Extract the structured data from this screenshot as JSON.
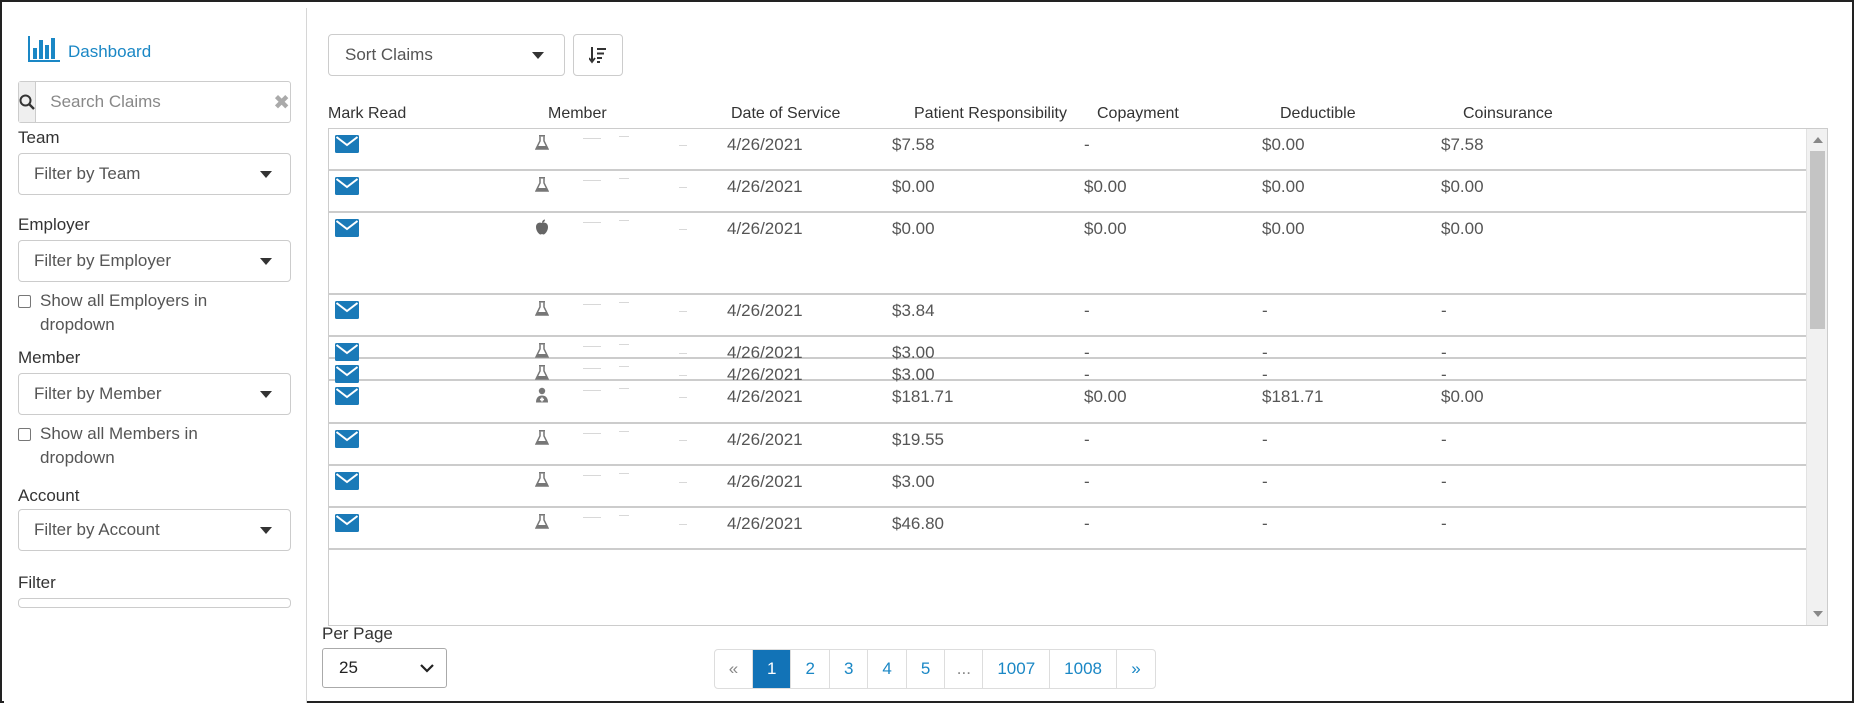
{
  "sidebar": {
    "dashboard_label": "Dashboard",
    "search": {
      "placeholder": "Search Claims",
      "clear_glyph": "✖"
    },
    "team": {
      "label": "Team",
      "placeholder": "Filter by Team"
    },
    "employer": {
      "label": "Employer",
      "placeholder": "Filter by Employer",
      "show_all_label": "Show all Employers in dropdown"
    },
    "member": {
      "label": "Member",
      "placeholder": "Filter by Member",
      "show_all_label": "Show all Members in dropdown"
    },
    "account": {
      "label": "Account",
      "placeholder": "Filter by Account"
    },
    "filter": {
      "label": "Filter"
    }
  },
  "toolbar": {
    "sort_placeholder": "Sort Claims"
  },
  "table": {
    "headers": {
      "mark_read": "Mark Read",
      "member": "Member",
      "date_of_service": "Date of Service",
      "patient_responsibility": "Patient Responsibility",
      "copayment": "Copayment",
      "deductible": "Deductible",
      "coinsurance": "Coinsurance"
    },
    "rows": [
      {
        "type_icon": "flask-icon",
        "date": "4/26/2021",
        "patient_resp": "$7.58",
        "copay": "-",
        "deductible": "$0.00",
        "coinsurance": "$7.58"
      },
      {
        "type_icon": "flask-icon",
        "date": "4/26/2021",
        "patient_resp": "$0.00",
        "copay": "$0.00",
        "deductible": "$0.00",
        "coinsurance": "$0.00"
      },
      {
        "type_icon": "apple-icon",
        "date": "4/26/2021",
        "patient_resp": "$0.00",
        "copay": "$0.00",
        "deductible": "$0.00",
        "coinsurance": "$0.00"
      },
      {
        "type_icon": "flask-icon",
        "date": "4/26/2021",
        "patient_resp": "$3.84",
        "copay": "-",
        "deductible": "-",
        "coinsurance": "-"
      },
      {
        "type_icon": "flask-icon",
        "date": "4/26/2021",
        "patient_resp": "$3.00",
        "copay": "-",
        "deductible": "-",
        "coinsurance": "-"
      },
      {
        "type_icon": "flask-icon",
        "date": "4/26/2021",
        "patient_resp": "$3.00",
        "copay": "-",
        "deductible": "-",
        "coinsurance": "-"
      },
      {
        "type_icon": "doctor-icon",
        "date": "4/26/2021",
        "patient_resp": "$181.71",
        "copay": "$0.00",
        "deductible": "$181.71",
        "coinsurance": "$0.00"
      },
      {
        "type_icon": "flask-icon",
        "date": "4/26/2021",
        "patient_resp": "$19.55",
        "copay": "-",
        "deductible": "-",
        "coinsurance": "-"
      },
      {
        "type_icon": "flask-icon",
        "date": "4/26/2021",
        "patient_resp": "$3.00",
        "copay": "-",
        "deductible": "-",
        "coinsurance": "-"
      },
      {
        "type_icon": "flask-icon",
        "date": "4/26/2021",
        "patient_resp": "$46.80",
        "copay": "-",
        "deductible": "-",
        "coinsurance": "-"
      }
    ]
  },
  "pagination": {
    "per_page_label": "Per Page",
    "per_page_value": "25",
    "pages": [
      "«",
      "1",
      "2",
      "3",
      "4",
      "5",
      "...",
      "1007",
      "1008",
      "»"
    ],
    "active_page": "1"
  },
  "colors": {
    "accent": "#1a87c5",
    "active_page": "#1273b7",
    "mail_icon": "#1a7ab8"
  }
}
